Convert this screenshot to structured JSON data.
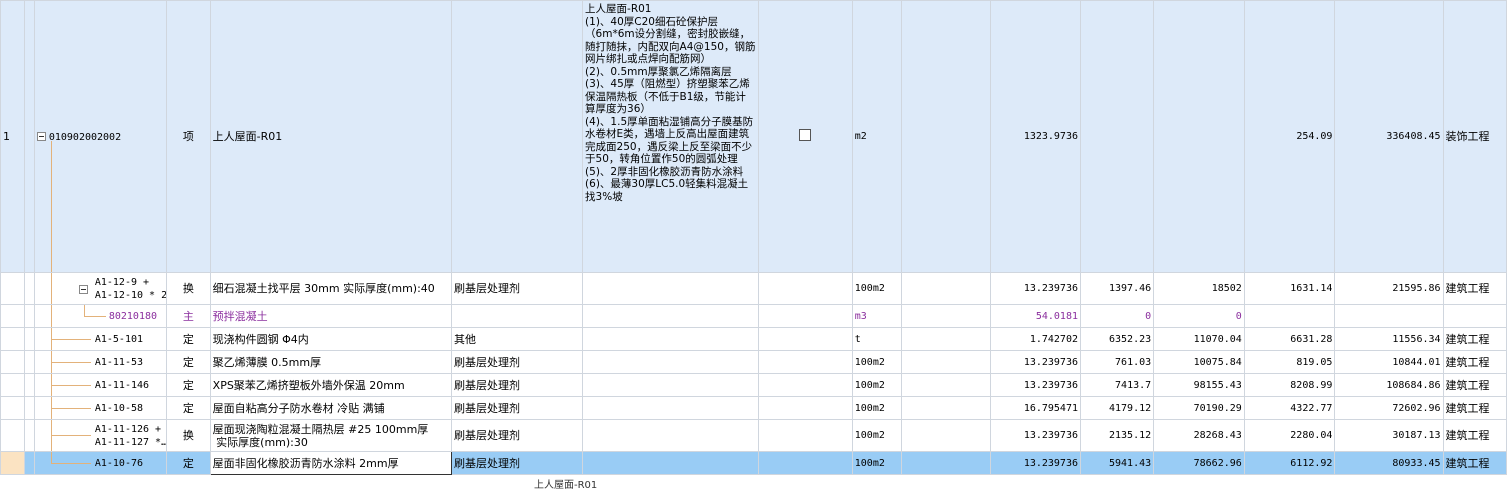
{
  "row1": {
    "row_no": "1",
    "code": "010902002002",
    "type": "项",
    "name": "上人屋面-R01",
    "description": "上人屋面-R01\n(1)、40厚C20细石砼保护层（6m*6m设分割缝，密封胶嵌缝，随打随抹，内配双向A4@150，钢筋网片绑扎或点焊向配筋网）\n(2)、0.5mm厚聚氯乙烯隔离层\n(3)、45厚（阻燃型）挤塑聚苯乙烯保温隔热板（不低于B1级，节能计算厚度为36）\n(4)、1.5厚单面粘湿铺高分子膜基防水卷材E类，遇墙上反高出屋面建筑完成面250，遇反梁上反至梁面不少于50，转角位置作50的圆弧处理\n(5)、2厚非固化橡胶沥青防水涂料\n(6)、最薄30厚LC5.0轻集料混凝土找3%坡",
    "unit": "m2",
    "quantity": "1323.9736",
    "unit_price": "254.09",
    "total": "336408.45",
    "category": "装饰工程"
  },
  "rows": [
    {
      "code_line1": "A1-12-9 +",
      "code_line2": "A1-12-10 * 2",
      "type": "换",
      "name": "细石混凝土找平层 30mm  实际厚度(mm):40",
      "material": "刷基层处理剂",
      "unit": "100m2",
      "qty": "13.239736",
      "c1": "1397.46",
      "c2": "18502",
      "c3": "1631.14",
      "c4": "21595.86",
      "cat": "建筑工程"
    },
    {
      "code": "80210180",
      "type": "主",
      "name": "预拌混凝土",
      "material": "",
      "unit": "m3",
      "qty": "54.0181",
      "c1": "0",
      "c2": "0",
      "c3": "",
      "c4": "",
      "cat": ""
    },
    {
      "code": "A1-5-101",
      "type": "定",
      "name": "现浇构件圆钢 Φ4内",
      "material": "其他",
      "unit": "t",
      "qty": "1.742702",
      "c1": "6352.23",
      "c2": "11070.04",
      "c3": "6631.28",
      "c4": "11556.34",
      "cat": "建筑工程"
    },
    {
      "code": "A1-11-53",
      "type": "定",
      "name": "聚乙烯薄膜 0.5mm厚",
      "material": "刷基层处理剂",
      "unit": "100m2",
      "qty": "13.239736",
      "c1": "761.03",
      "c2": "10075.84",
      "c3": "819.05",
      "c4": "10844.01",
      "cat": "建筑工程"
    },
    {
      "code": "A1-11-146",
      "type": "定",
      "name": "XPS聚苯乙烯挤塑板外墙外保温 20mm",
      "material": "刷基层处理剂",
      "unit": "100m2",
      "qty": "13.239736",
      "c1": "7413.7",
      "c2": "98155.43",
      "c3": "8208.99",
      "c4": "108684.86",
      "cat": "建筑工程"
    },
    {
      "code": "A1-10-58",
      "type": "定",
      "name": "屋面自粘高分子防水卷材 冷贴 满铺",
      "material": "刷基层处理剂",
      "unit": "100m2",
      "qty": "16.795471",
      "c1": "4179.12",
      "c2": "70190.29",
      "c3": "4322.77",
      "c4": "72602.96",
      "cat": "建筑工程"
    },
    {
      "code_line1": "A1-11-126 +",
      "code_line2": "A1-11-127 *…",
      "type": "换",
      "name_line1": "屋面现浇陶粒混凝土隔热层 #25 100mm厚",
      "name_line2": " 实际厚度(mm):30",
      "material": "刷基层处理剂",
      "unit": "100m2",
      "qty": "13.239736",
      "c1": "2135.12",
      "c2": "28268.43",
      "c3": "2280.04",
      "c4": "30187.13",
      "cat": "建筑工程"
    },
    {
      "code": "A1-10-76",
      "type": "定",
      "name": "屋面非固化橡胶沥青防水涂料 2mm厚",
      "material": "刷基层处理剂",
      "unit": "100m2",
      "qty": "13.239736",
      "c1": "5941.43",
      "c2": "78662.96",
      "c3": "6112.92",
      "c4": "80933.45",
      "cat": "建筑工程"
    }
  ],
  "overflow_text": "上人屋面-R01"
}
